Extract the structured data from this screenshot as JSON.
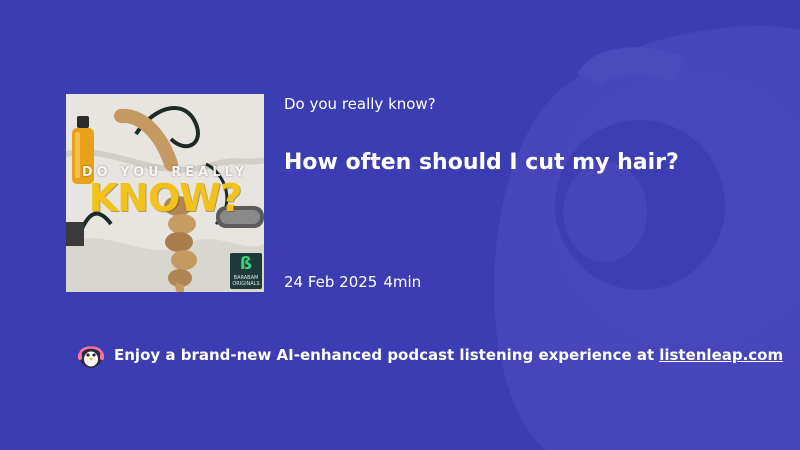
{
  "episode": {
    "show_name": "Do you really know?",
    "title": "How often should I cut my hair?",
    "date": "24 Feb 2025",
    "duration": "4min"
  },
  "cover": {
    "line1": "DO YOU REALLY",
    "line2": "KNOW?",
    "badge_line1": "BARABAM",
    "badge_line2": "ORIGINALS",
    "accent_color": "#f2c21a"
  },
  "promo": {
    "icon": "penguin-headphones-icon",
    "text": "Enjoy a brand-new AI-enhanced podcast listening experience at",
    "link": "listenleap.com"
  },
  "colors": {
    "background": "#3d3db3",
    "watermark": "#4a4abd"
  }
}
